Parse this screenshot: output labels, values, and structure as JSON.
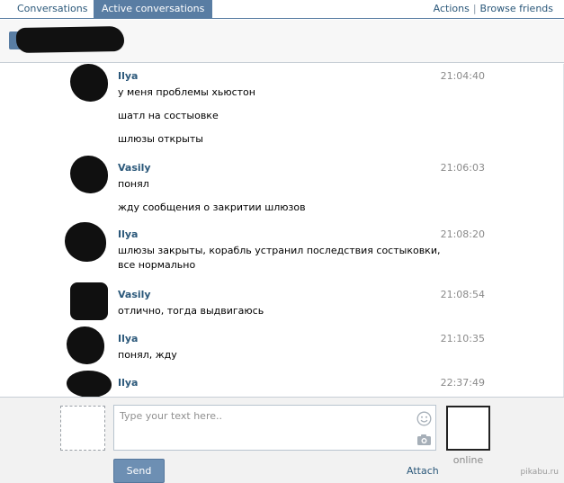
{
  "tabs": [
    {
      "label": "Conversations",
      "active": false
    },
    {
      "label": "Active conversations",
      "active": true
    }
  ],
  "actions": {
    "actions_label": "Actions",
    "separator": "|",
    "browse_label": "Browse friends"
  },
  "messages": [
    {
      "author": "Ilya",
      "time": "21:04:40",
      "lines": [
        "у меня проблемы хьюстон",
        "шатл на состыовке",
        "шлюзы открыты"
      ]
    },
    {
      "author": "Vasily",
      "time": "21:06:03",
      "lines": [
        "понял",
        "жду сообщения о закритии шлюзов"
      ]
    },
    {
      "author": "Ilya",
      "time": "21:08:20",
      "lines": [
        "шлюзы закрыты, корабль устранил последствия состыковки, все нормально"
      ]
    },
    {
      "author": "Vasily",
      "time": "21:08:54",
      "lines": [
        "отлично, тогда выдвигаюсь"
      ]
    },
    {
      "author": "Ilya",
      "time": "21:10:35",
      "lines": [
        "понял, жду"
      ]
    },
    {
      "author": "Ilya",
      "time": "22:37:49",
      "lines": []
    }
  ],
  "composer": {
    "placeholder": "Type your text here..",
    "send_label": "Send",
    "attach_label": "Attach",
    "status": "online"
  },
  "watermark": "pikabu.ru",
  "colors": {
    "accent": "#597da3",
    "link": "#2b587a",
    "muted": "#8a8a8a"
  },
  "icons": [
    "smile-icon",
    "camera-icon"
  ]
}
